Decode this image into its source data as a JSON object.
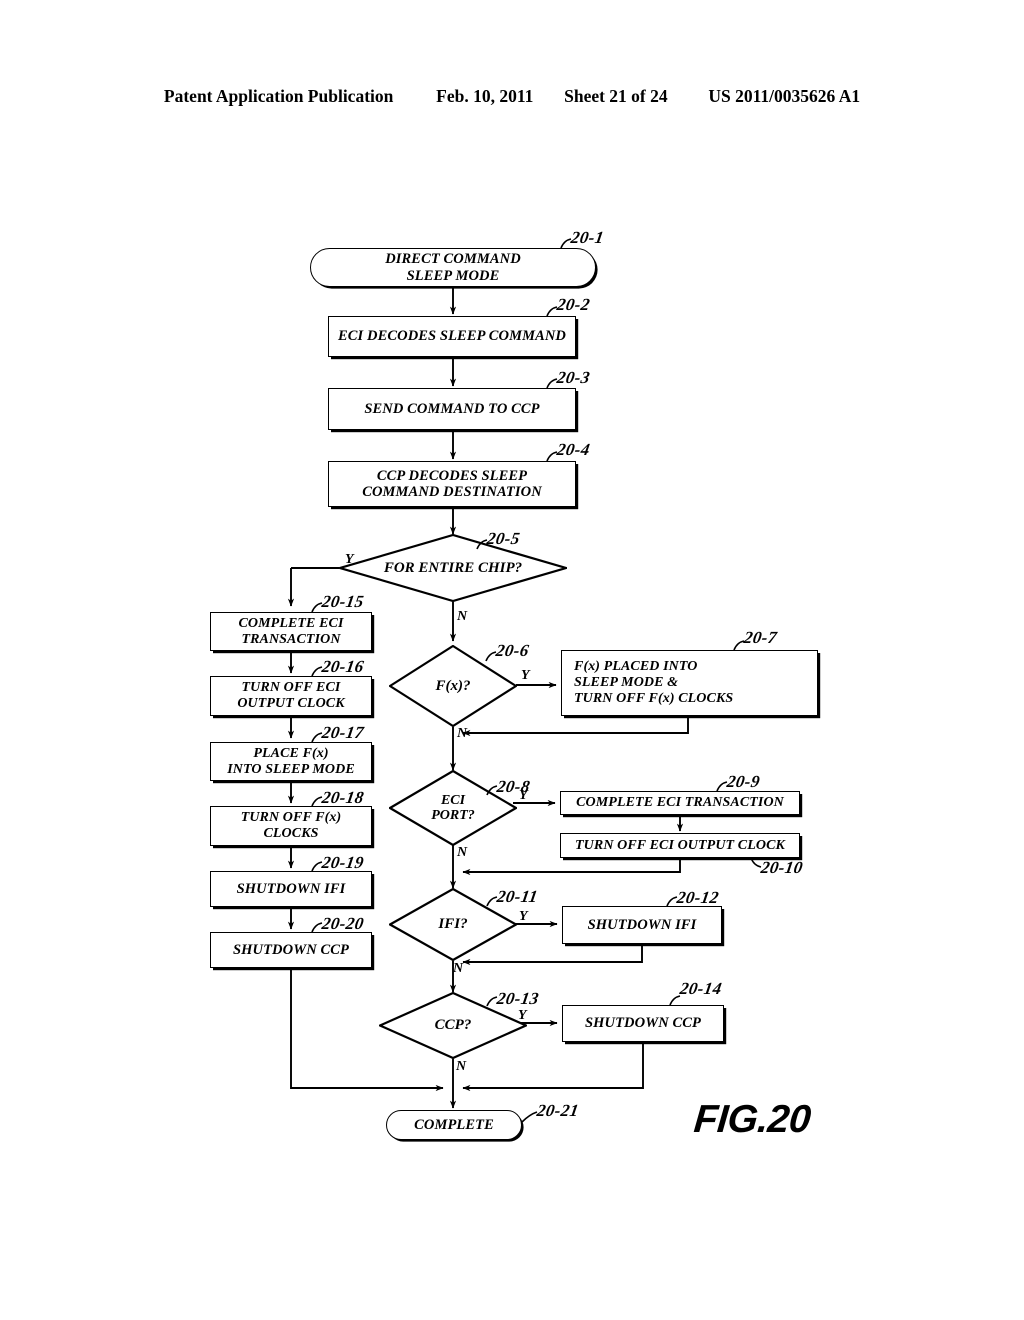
{
  "header": {
    "publication": "Patent Application Publication",
    "date": "Feb. 10, 2011",
    "sheet": "Sheet 21 of 24",
    "docnum": "US 2011/0035626 A1"
  },
  "figure": {
    "label": "FIG.20"
  },
  "nodes": {
    "n20_1": {
      "ref": "20-1",
      "text": "DIRECT COMMAND\nSLEEP MODE"
    },
    "n20_2": {
      "ref": "20-2",
      "text": "ECI DECODES SLEEP COMMAND"
    },
    "n20_3": {
      "ref": "20-3",
      "text": "SEND COMMAND TO CCP"
    },
    "n20_4": {
      "ref": "20-4",
      "text": "CCP DECODES SLEEP\nCOMMAND DESTINATION"
    },
    "n20_5": {
      "ref": "20-5",
      "text": "FOR ENTIRE CHIP?"
    },
    "n20_6": {
      "ref": "20-6",
      "text": "F(x)?"
    },
    "n20_7": {
      "ref": "20-7",
      "text": "F(x) PLACED INTO\nSLEEP MODE      &\nTURN OFF F(x) CLOCKS"
    },
    "n20_8": {
      "ref": "20-8",
      "text": "ECI\nPORT?"
    },
    "n20_9": {
      "ref": "20-9",
      "text": "COMPLETE ECI TRANSACTION"
    },
    "n20_10": {
      "ref": "20-10",
      "text": "TURN OFF ECI OUTPUT CLOCK"
    },
    "n20_11": {
      "ref": "20-11",
      "text": "IFI?"
    },
    "n20_12": {
      "ref": "20-12",
      "text": "SHUTDOWN IFI"
    },
    "n20_13": {
      "ref": "20-13",
      "text": "CCP?"
    },
    "n20_14": {
      "ref": "20-14",
      "text": "SHUTDOWN CCP"
    },
    "n20_15": {
      "ref": "20-15",
      "text": "COMPLETE ECI\nTRANSACTION"
    },
    "n20_16": {
      "ref": "20-16",
      "text": "TURN OFF ECI\nOUTPUT CLOCK"
    },
    "n20_17": {
      "ref": "20-17",
      "text": "PLACE F(x)\nINTO SLEEP  MODE"
    },
    "n20_18": {
      "ref": "20-18",
      "text": "TURN OFF F(x)\nCLOCKS"
    },
    "n20_19": {
      "ref": "20-19",
      "text": "SHUTDOWN IFI"
    },
    "n20_20": {
      "ref": "20-20",
      "text": "SHUTDOWN CCP"
    },
    "n20_21": {
      "ref": "20-21",
      "text": "COMPLETE"
    }
  },
  "branch_labels": {
    "chip_yes": "Y",
    "chip_no": "N",
    "fx_yes": "Y",
    "fx_no": "N",
    "eci_yes": "Y",
    "eci_no": "N",
    "ifi_yes": "Y",
    "ifi_no": "N",
    "ccp_yes": "Y",
    "ccp_no": "N"
  },
  "colors": {
    "ink": "#000000",
    "paper": "#ffffff"
  }
}
